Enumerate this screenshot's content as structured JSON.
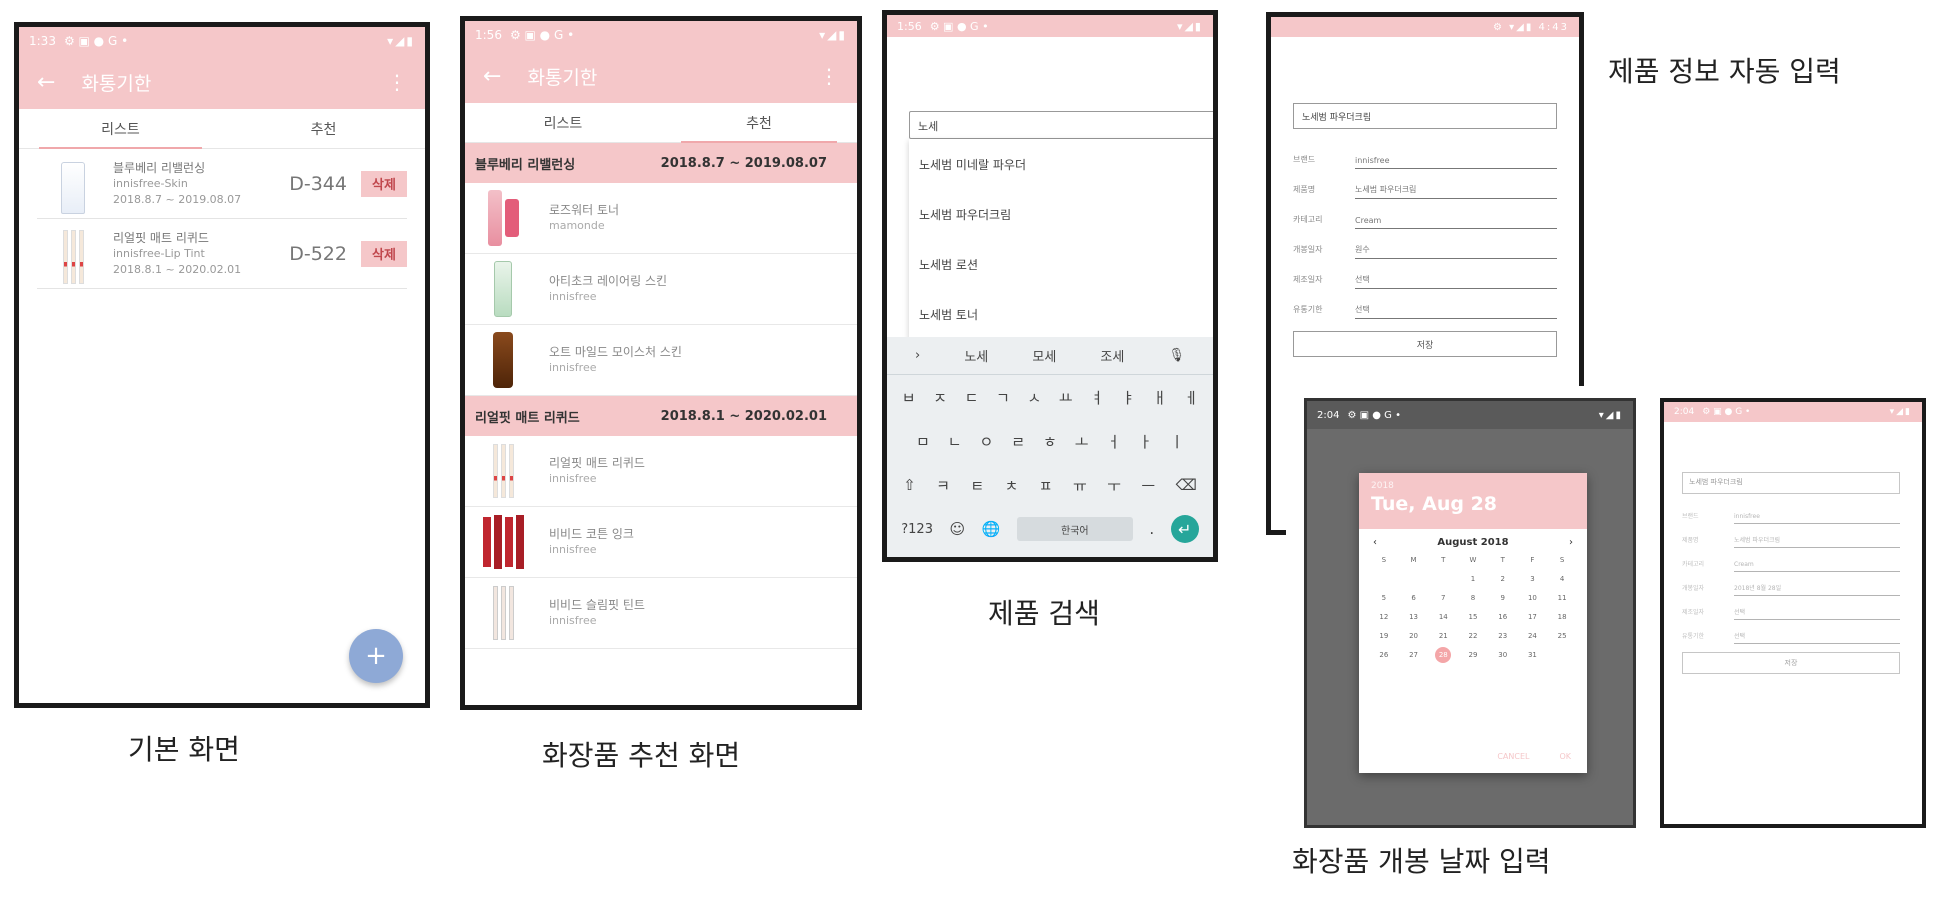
{
  "screen1": {
    "status_time": "1:33",
    "status_icons": "⚙ ▣ ● G •",
    "status_right": "▾◢▮",
    "title": "화통기한",
    "tabs": [
      "리스트",
      "추천"
    ],
    "items": [
      {
        "name": "블루베리 리밸런싱",
        "brand": "innisfree-Skin",
        "period": "2018.8.7 ~ 2019.08.07",
        "dday": "D-344",
        "delete": "삭제"
      },
      {
        "name": "리얼핏 매트 리퀴드",
        "brand": "innisfree-Lip Tint",
        "period": "2018.8.1 ~ 2020.02.01",
        "dday": "D-522",
        "delete": "삭제"
      }
    ],
    "fab": "+",
    "caption": "기본 화면"
  },
  "screen2": {
    "status_time": "1:56",
    "status_icons": "⚙ ▣ ● G •",
    "status_right": "▾◢▮",
    "title": "화통기한",
    "tabs": [
      "리스트",
      "추천"
    ],
    "groups": [
      {
        "header": "블루베리 리밸런싱",
        "period": "2018.8.7 ~ 2019.08.07",
        "items": [
          {
            "name": "로즈워터 토너",
            "brand": "mamonde"
          },
          {
            "name": "아티초크 레이어링 스킨",
            "brand": "innisfree"
          },
          {
            "name": "오트 마일드 모이스처 스킨",
            "brand": "innisfree"
          }
        ]
      },
      {
        "header": "리얼핏 매트 리퀴드",
        "period": "2018.8.1 ~ 2020.02.01",
        "items": [
          {
            "name": "리얼핏 매트 리퀴드",
            "brand": "innisfree"
          },
          {
            "name": "비비드 코튼 잉크",
            "brand": "innisfree"
          },
          {
            "name": "비비드 슬림핏 틴트",
            "brand": "innisfree"
          }
        ]
      }
    ],
    "caption": "화장품 추천 화면"
  },
  "screen3": {
    "status_time": "1:56",
    "status_icons": "⚙ ▣ ● G •",
    "status_right": "▾◢▮",
    "search_value": "노세",
    "suggestions": [
      "노세범 미네랄 파우더",
      "노세범 파우더크림",
      "노세범 로션",
      "노세범 토너"
    ],
    "kb_suggestions": [
      "노세",
      "모세",
      "조세"
    ],
    "kb_row1": [
      "ㅂ",
      "ㅈ",
      "ㄷ",
      "ㄱ",
      "ㅅ",
      "ㅛ",
      "ㅕ",
      "ㅑ",
      "ㅐ",
      "ㅔ"
    ],
    "kb_row2": [
      "ㅁ",
      "ㄴ",
      "ㅇ",
      "ㄹ",
      "ㅎ",
      "ㅗ",
      "ㅓ",
      "ㅏ",
      "ㅣ"
    ],
    "kb_row3": [
      "⇧",
      "ㅋ",
      "ㅌ",
      "ㅊ",
      "ㅍ",
      "ㅠ",
      "ㅜ",
      "ㅡ",
      "⌫"
    ],
    "kb_sym": "?123",
    "kb_space": "한국어",
    "kb_enter": "↵",
    "caption": "제품 검색"
  },
  "screen4": {
    "status_right": "⚙ ▾◢▮ 4:43",
    "product": "노세범 파우더크림",
    "fields": [
      {
        "label": "브랜드",
        "value": "innisfree"
      },
      {
        "label": "제품명",
        "value": "노세범 파우더크림"
      },
      {
        "label": "카테고리",
        "value": "Cream"
      },
      {
        "label": "개봉일자",
        "value": "원수"
      },
      {
        "label": "제조일자",
        "value": "선택"
      },
      {
        "label": "유통기한",
        "value": "선택"
      }
    ],
    "save": "저장",
    "caption": "제품 정보 자동 입력"
  },
  "screen5": {
    "status_time": "2:04",
    "status_icons": "⚙ ▣ ● G •",
    "status_right": "▾◢▮",
    "year": "2018",
    "selected_date": "Tue, Aug 28",
    "month": "August 2018",
    "weekdays": [
      "S",
      "M",
      "T",
      "W",
      "T",
      "F",
      "S"
    ],
    "days": [
      "",
      "",
      "",
      "1",
      "2",
      "3",
      "4",
      "5",
      "6",
      "7",
      "8",
      "9",
      "10",
      "11",
      "12",
      "13",
      "14",
      "15",
      "16",
      "17",
      "18",
      "19",
      "20",
      "21",
      "22",
      "23",
      "24",
      "25",
      "26",
      "27",
      "28",
      "29",
      "30",
      "31",
      "",
      ""
    ],
    "selected_day": "28",
    "cancel": "CANCEL",
    "ok": "OK",
    "caption": "화장품 개봉 날짜 입력"
  },
  "screen6": {
    "status_time": "2:04",
    "status_icons": "⚙ ▣ ● G •",
    "status_right": "▾◢▮",
    "product": "노세범 파우더크림",
    "fields": [
      {
        "label": "브랜드",
        "value": "innisfree"
      },
      {
        "label": "제품명",
        "value": "노세범 파우더크림"
      },
      {
        "label": "카테고리",
        "value": "Cream"
      },
      {
        "label": "개봉일자",
        "value": "2018년 8월 28일"
      },
      {
        "label": "제조일자",
        "value": "선택"
      },
      {
        "label": "유통기한",
        "value": "선택"
      }
    ],
    "save": "저장"
  },
  "colors": {
    "accent_pink": "#f5c7c9",
    "fab_blue": "#8ea9d6",
    "enter_teal": "#26a69a"
  }
}
